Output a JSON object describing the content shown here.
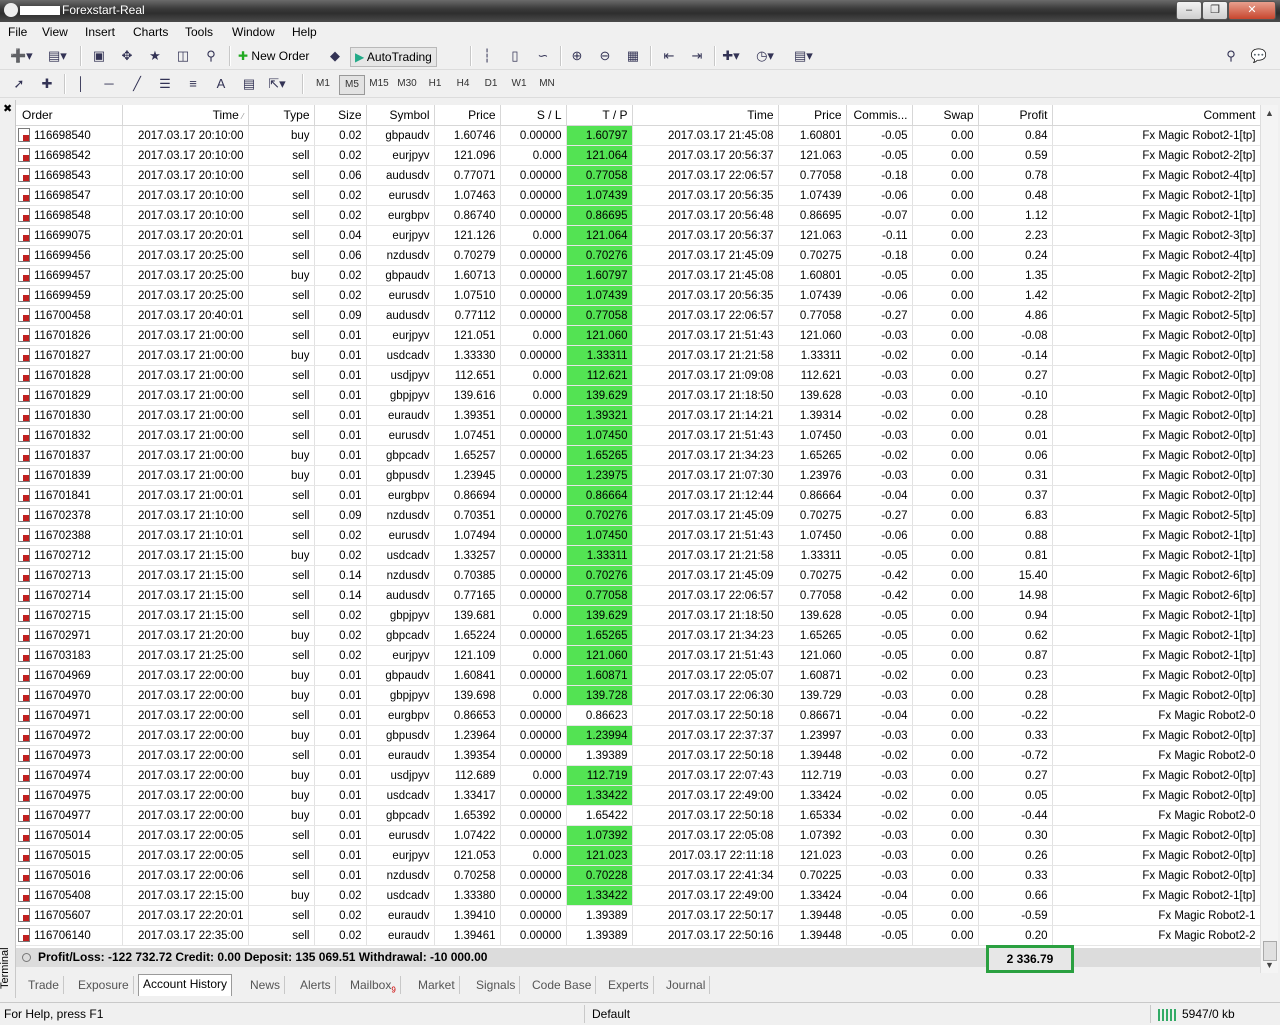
{
  "window": {
    "title": "Forexstart-Real"
  },
  "menu": [
    "File",
    "View",
    "Insert",
    "Charts",
    "Tools",
    "Window",
    "Help"
  ],
  "toolbar": {
    "new_order": "New Order",
    "autotrading": "AutoTrading"
  },
  "timeframes": [
    "M1",
    "M5",
    "M15",
    "M30",
    "H1",
    "H4",
    "D1",
    "W1",
    "MN"
  ],
  "active_timeframe": "M5",
  "columns": [
    "Order",
    "Time",
    "Type",
    "Size",
    "Symbol",
    "Price",
    "S / L",
    "T / P",
    "Time",
    "Price",
    "Commis...",
    "Swap",
    "Profit",
    "Comment"
  ],
  "rows": [
    {
      "order": "116698540",
      "open_time": "2017.03.17 20:10:00",
      "type": "buy",
      "size": "0.02",
      "symbol": "gbpaudv",
      "price": "1.60746",
      "sl": "0.00000",
      "tp": "1.60797",
      "close_time": "2017.03.17 21:45:08",
      "close_price": "1.60801",
      "commission": "-0.05",
      "swap": "0.00",
      "profit": "0.84",
      "comment": "Fx Magic Robot2-1[tp]",
      "tp_hit": true
    },
    {
      "order": "116698542",
      "open_time": "2017.03.17 20:10:00",
      "type": "sell",
      "size": "0.02",
      "symbol": "eurjpyv",
      "price": "121.096",
      "sl": "0.000",
      "tp": "121.064",
      "close_time": "2017.03.17 20:56:37",
      "close_price": "121.063",
      "commission": "-0.05",
      "swap": "0.00",
      "profit": "0.59",
      "comment": "Fx Magic Robot2-2[tp]",
      "tp_hit": true
    },
    {
      "order": "116698543",
      "open_time": "2017.03.17 20:10:00",
      "type": "sell",
      "size": "0.06",
      "symbol": "audusdv",
      "price": "0.77071",
      "sl": "0.00000",
      "tp": "0.77058",
      "close_time": "2017.03.17 22:06:57",
      "close_price": "0.77058",
      "commission": "-0.18",
      "swap": "0.00",
      "profit": "0.78",
      "comment": "Fx Magic Robot2-4[tp]",
      "tp_hit": true
    },
    {
      "order": "116698547",
      "open_time": "2017.03.17 20:10:00",
      "type": "sell",
      "size": "0.02",
      "symbol": "eurusdv",
      "price": "1.07463",
      "sl": "0.00000",
      "tp": "1.07439",
      "close_time": "2017.03.17 20:56:35",
      "close_price": "1.07439",
      "commission": "-0.06",
      "swap": "0.00",
      "profit": "0.48",
      "comment": "Fx Magic Robot2-1[tp]",
      "tp_hit": true
    },
    {
      "order": "116698548",
      "open_time": "2017.03.17 20:10:00",
      "type": "sell",
      "size": "0.02",
      "symbol": "eurgbpv",
      "price": "0.86740",
      "sl": "0.00000",
      "tp": "0.86695",
      "close_time": "2017.03.17 20:56:48",
      "close_price": "0.86695",
      "commission": "-0.07",
      "swap": "0.00",
      "profit": "1.12",
      "comment": "Fx Magic Robot2-1[tp]",
      "tp_hit": true
    },
    {
      "order": "116699075",
      "open_time": "2017.03.17 20:20:01",
      "type": "sell",
      "size": "0.04",
      "symbol": "eurjpyv",
      "price": "121.126",
      "sl": "0.000",
      "tp": "121.064",
      "close_time": "2017.03.17 20:56:37",
      "close_price": "121.063",
      "commission": "-0.11",
      "swap": "0.00",
      "profit": "2.23",
      "comment": "Fx Magic Robot2-3[tp]",
      "tp_hit": true
    },
    {
      "order": "116699456",
      "open_time": "2017.03.17 20:25:00",
      "type": "sell",
      "size": "0.06",
      "symbol": "nzdusdv",
      "price": "0.70279",
      "sl": "0.00000",
      "tp": "0.70276",
      "close_time": "2017.03.17 21:45:09",
      "close_price": "0.70275",
      "commission": "-0.18",
      "swap": "0.00",
      "profit": "0.24",
      "comment": "Fx Magic Robot2-4[tp]",
      "tp_hit": true
    },
    {
      "order": "116699457",
      "open_time": "2017.03.17 20:25:00",
      "type": "buy",
      "size": "0.02",
      "symbol": "gbpaudv",
      "price": "1.60713",
      "sl": "0.00000",
      "tp": "1.60797",
      "close_time": "2017.03.17 21:45:08",
      "close_price": "1.60801",
      "commission": "-0.05",
      "swap": "0.00",
      "profit": "1.35",
      "comment": "Fx Magic Robot2-2[tp]",
      "tp_hit": true
    },
    {
      "order": "116699459",
      "open_time": "2017.03.17 20:25:00",
      "type": "sell",
      "size": "0.02",
      "symbol": "eurusdv",
      "price": "1.07510",
      "sl": "0.00000",
      "tp": "1.07439",
      "close_time": "2017.03.17 20:56:35",
      "close_price": "1.07439",
      "commission": "-0.06",
      "swap": "0.00",
      "profit": "1.42",
      "comment": "Fx Magic Robot2-2[tp]",
      "tp_hit": true
    },
    {
      "order": "116700458",
      "open_time": "2017.03.17 20:40:01",
      "type": "sell",
      "size": "0.09",
      "symbol": "audusdv",
      "price": "0.77112",
      "sl": "0.00000",
      "tp": "0.77058",
      "close_time": "2017.03.17 22:06:57",
      "close_price": "0.77058",
      "commission": "-0.27",
      "swap": "0.00",
      "profit": "4.86",
      "comment": "Fx Magic Robot2-5[tp]",
      "tp_hit": true
    },
    {
      "order": "116701826",
      "open_time": "2017.03.17 21:00:00",
      "type": "sell",
      "size": "0.01",
      "symbol": "eurjpyv",
      "price": "121.051",
      "sl": "0.000",
      "tp": "121.060",
      "close_time": "2017.03.17 21:51:43",
      "close_price": "121.060",
      "commission": "-0.03",
      "swap": "0.00",
      "profit": "-0.08",
      "comment": "Fx Magic Robot2-0[tp]",
      "tp_hit": true
    },
    {
      "order": "116701827",
      "open_time": "2017.03.17 21:00:00",
      "type": "buy",
      "size": "0.01",
      "symbol": "usdcadv",
      "price": "1.33330",
      "sl": "0.00000",
      "tp": "1.33311",
      "close_time": "2017.03.17 21:21:58",
      "close_price": "1.33311",
      "commission": "-0.02",
      "swap": "0.00",
      "profit": "-0.14",
      "comment": "Fx Magic Robot2-0[tp]",
      "tp_hit": true
    },
    {
      "order": "116701828",
      "open_time": "2017.03.17 21:00:00",
      "type": "sell",
      "size": "0.01",
      "symbol": "usdjpyv",
      "price": "112.651",
      "sl": "0.000",
      "tp": "112.621",
      "close_time": "2017.03.17 21:09:08",
      "close_price": "112.621",
      "commission": "-0.03",
      "swap": "0.00",
      "profit": "0.27",
      "comment": "Fx Magic Robot2-0[tp]",
      "tp_hit": true
    },
    {
      "order": "116701829",
      "open_time": "2017.03.17 21:00:00",
      "type": "sell",
      "size": "0.01",
      "symbol": "gbpjpyv",
      "price": "139.616",
      "sl": "0.000",
      "tp": "139.629",
      "close_time": "2017.03.17 21:18:50",
      "close_price": "139.628",
      "commission": "-0.03",
      "swap": "0.00",
      "profit": "-0.10",
      "comment": "Fx Magic Robot2-0[tp]",
      "tp_hit": true
    },
    {
      "order": "116701830",
      "open_time": "2017.03.17 21:00:00",
      "type": "sell",
      "size": "0.01",
      "symbol": "euraudv",
      "price": "1.39351",
      "sl": "0.00000",
      "tp": "1.39321",
      "close_time": "2017.03.17 21:14:21",
      "close_price": "1.39314",
      "commission": "-0.02",
      "swap": "0.00",
      "profit": "0.28",
      "comment": "Fx Magic Robot2-0[tp]",
      "tp_hit": true
    },
    {
      "order": "116701832",
      "open_time": "2017.03.17 21:00:00",
      "type": "sell",
      "size": "0.01",
      "symbol": "eurusdv",
      "price": "1.07451",
      "sl": "0.00000",
      "tp": "1.07450",
      "close_time": "2017.03.17 21:51:43",
      "close_price": "1.07450",
      "commission": "-0.03",
      "swap": "0.00",
      "profit": "0.01",
      "comment": "Fx Magic Robot2-0[tp]",
      "tp_hit": true
    },
    {
      "order": "116701837",
      "open_time": "2017.03.17 21:00:00",
      "type": "buy",
      "size": "0.01",
      "symbol": "gbpcadv",
      "price": "1.65257",
      "sl": "0.00000",
      "tp": "1.65265",
      "close_time": "2017.03.17 21:34:23",
      "close_price": "1.65265",
      "commission": "-0.02",
      "swap": "0.00",
      "profit": "0.06",
      "comment": "Fx Magic Robot2-0[tp]",
      "tp_hit": true
    },
    {
      "order": "116701839",
      "open_time": "2017.03.17 21:00:00",
      "type": "buy",
      "size": "0.01",
      "symbol": "gbpusdv",
      "price": "1.23945",
      "sl": "0.00000",
      "tp": "1.23975",
      "close_time": "2017.03.17 21:07:30",
      "close_price": "1.23976",
      "commission": "-0.03",
      "swap": "0.00",
      "profit": "0.31",
      "comment": "Fx Magic Robot2-0[tp]",
      "tp_hit": true
    },
    {
      "order": "116701841",
      "open_time": "2017.03.17 21:00:01",
      "type": "sell",
      "size": "0.01",
      "symbol": "eurgbpv",
      "price": "0.86694",
      "sl": "0.00000",
      "tp": "0.86664",
      "close_time": "2017.03.17 21:12:44",
      "close_price": "0.86664",
      "commission": "-0.04",
      "swap": "0.00",
      "profit": "0.37",
      "comment": "Fx Magic Robot2-0[tp]",
      "tp_hit": true
    },
    {
      "order": "116702378",
      "open_time": "2017.03.17 21:10:00",
      "type": "sell",
      "size": "0.09",
      "symbol": "nzdusdv",
      "price": "0.70351",
      "sl": "0.00000",
      "tp": "0.70276",
      "close_time": "2017.03.17 21:45:09",
      "close_price": "0.70275",
      "commission": "-0.27",
      "swap": "0.00",
      "profit": "6.83",
      "comment": "Fx Magic Robot2-5[tp]",
      "tp_hit": true
    },
    {
      "order": "116702388",
      "open_time": "2017.03.17 21:10:01",
      "type": "sell",
      "size": "0.02",
      "symbol": "eurusdv",
      "price": "1.07494",
      "sl": "0.00000",
      "tp": "1.07450",
      "close_time": "2017.03.17 21:51:43",
      "close_price": "1.07450",
      "commission": "-0.06",
      "swap": "0.00",
      "profit": "0.88",
      "comment": "Fx Magic Robot2-1[tp]",
      "tp_hit": true
    },
    {
      "order": "116702712",
      "open_time": "2017.03.17 21:15:00",
      "type": "buy",
      "size": "0.02",
      "symbol": "usdcadv",
      "price": "1.33257",
      "sl": "0.00000",
      "tp": "1.33311",
      "close_time": "2017.03.17 21:21:58",
      "close_price": "1.33311",
      "commission": "-0.05",
      "swap": "0.00",
      "profit": "0.81",
      "comment": "Fx Magic Robot2-1[tp]",
      "tp_hit": true
    },
    {
      "order": "116702713",
      "open_time": "2017.03.17 21:15:00",
      "type": "sell",
      "size": "0.14",
      "symbol": "nzdusdv",
      "price": "0.70385",
      "sl": "0.00000",
      "tp": "0.70276",
      "close_time": "2017.03.17 21:45:09",
      "close_price": "0.70275",
      "commission": "-0.42",
      "swap": "0.00",
      "profit": "15.40",
      "comment": "Fx Magic Robot2-6[tp]",
      "tp_hit": true
    },
    {
      "order": "116702714",
      "open_time": "2017.03.17 21:15:00",
      "type": "sell",
      "size": "0.14",
      "symbol": "audusdv",
      "price": "0.77165",
      "sl": "0.00000",
      "tp": "0.77058",
      "close_time": "2017.03.17 22:06:57",
      "close_price": "0.77058",
      "commission": "-0.42",
      "swap": "0.00",
      "profit": "14.98",
      "comment": "Fx Magic Robot2-6[tp]",
      "tp_hit": true
    },
    {
      "order": "116702715",
      "open_time": "2017.03.17 21:15:00",
      "type": "sell",
      "size": "0.02",
      "symbol": "gbpjpyv",
      "price": "139.681",
      "sl": "0.000",
      "tp": "139.629",
      "close_time": "2017.03.17 21:18:50",
      "close_price": "139.628",
      "commission": "-0.05",
      "swap": "0.00",
      "profit": "0.94",
      "comment": "Fx Magic Robot2-1[tp]",
      "tp_hit": true
    },
    {
      "order": "116702971",
      "open_time": "2017.03.17 21:20:00",
      "type": "buy",
      "size": "0.02",
      "symbol": "gbpcadv",
      "price": "1.65224",
      "sl": "0.00000",
      "tp": "1.65265",
      "close_time": "2017.03.17 21:34:23",
      "close_price": "1.65265",
      "commission": "-0.05",
      "swap": "0.00",
      "profit": "0.62",
      "comment": "Fx Magic Robot2-1[tp]",
      "tp_hit": true
    },
    {
      "order": "116703183",
      "open_time": "2017.03.17 21:25:00",
      "type": "sell",
      "size": "0.02",
      "symbol": "eurjpyv",
      "price": "121.109",
      "sl": "0.000",
      "tp": "121.060",
      "close_time": "2017.03.17 21:51:43",
      "close_price": "121.060",
      "commission": "-0.05",
      "swap": "0.00",
      "profit": "0.87",
      "comment": "Fx Magic Robot2-1[tp]",
      "tp_hit": true
    },
    {
      "order": "116704969",
      "open_time": "2017.03.17 22:00:00",
      "type": "buy",
      "size": "0.01",
      "symbol": "gbpaudv",
      "price": "1.60841",
      "sl": "0.00000",
      "tp": "1.60871",
      "close_time": "2017.03.17 22:05:07",
      "close_price": "1.60871",
      "commission": "-0.02",
      "swap": "0.00",
      "profit": "0.23",
      "comment": "Fx Magic Robot2-0[tp]",
      "tp_hit": true
    },
    {
      "order": "116704970",
      "open_time": "2017.03.17 22:00:00",
      "type": "buy",
      "size": "0.01",
      "symbol": "gbpjpyv",
      "price": "139.698",
      "sl": "0.000",
      "tp": "139.728",
      "close_time": "2017.03.17 22:06:30",
      "close_price": "139.729",
      "commission": "-0.03",
      "swap": "0.00",
      "profit": "0.28",
      "comment": "Fx Magic Robot2-0[tp]",
      "tp_hit": true
    },
    {
      "order": "116704971",
      "open_time": "2017.03.17 22:00:00",
      "type": "sell",
      "size": "0.01",
      "symbol": "eurgbpv",
      "price": "0.86653",
      "sl": "0.00000",
      "tp": "0.86623",
      "close_time": "2017.03.17 22:50:18",
      "close_price": "0.86671",
      "commission": "-0.04",
      "swap": "0.00",
      "profit": "-0.22",
      "comment": "Fx Magic Robot2-0",
      "tp_hit": false
    },
    {
      "order": "116704972",
      "open_time": "2017.03.17 22:00:00",
      "type": "buy",
      "size": "0.01",
      "symbol": "gbpusdv",
      "price": "1.23964",
      "sl": "0.00000",
      "tp": "1.23994",
      "close_time": "2017.03.17 22:37:37",
      "close_price": "1.23997",
      "commission": "-0.03",
      "swap": "0.00",
      "profit": "0.33",
      "comment": "Fx Magic Robot2-0[tp]",
      "tp_hit": true
    },
    {
      "order": "116704973",
      "open_time": "2017.03.17 22:00:00",
      "type": "sell",
      "size": "0.01",
      "symbol": "euraudv",
      "price": "1.39354",
      "sl": "0.00000",
      "tp": "1.39389",
      "close_time": "2017.03.17 22:50:18",
      "close_price": "1.39448",
      "commission": "-0.02",
      "swap": "0.00",
      "profit": "-0.72",
      "comment": "Fx Magic Robot2-0",
      "tp_hit": false
    },
    {
      "order": "116704974",
      "open_time": "2017.03.17 22:00:00",
      "type": "buy",
      "size": "0.01",
      "symbol": "usdjpyv",
      "price": "112.689",
      "sl": "0.000",
      "tp": "112.719",
      "close_time": "2017.03.17 22:07:43",
      "close_price": "112.719",
      "commission": "-0.03",
      "swap": "0.00",
      "profit": "0.27",
      "comment": "Fx Magic Robot2-0[tp]",
      "tp_hit": true
    },
    {
      "order": "116704975",
      "open_time": "2017.03.17 22:00:00",
      "type": "buy",
      "size": "0.01",
      "symbol": "usdcadv",
      "price": "1.33417",
      "sl": "0.00000",
      "tp": "1.33422",
      "close_time": "2017.03.17 22:49:00",
      "close_price": "1.33424",
      "commission": "-0.02",
      "swap": "0.00",
      "profit": "0.05",
      "comment": "Fx Magic Robot2-0[tp]",
      "tp_hit": true
    },
    {
      "order": "116704977",
      "open_time": "2017.03.17 22:00:00",
      "type": "buy",
      "size": "0.01",
      "symbol": "gbpcadv",
      "price": "1.65392",
      "sl": "0.00000",
      "tp": "1.65422",
      "close_time": "2017.03.17 22:50:18",
      "close_price": "1.65334",
      "commission": "-0.02",
      "swap": "0.00",
      "profit": "-0.44",
      "comment": "Fx Magic Robot2-0",
      "tp_hit": false
    },
    {
      "order": "116705014",
      "open_time": "2017.03.17 22:00:05",
      "type": "sell",
      "size": "0.01",
      "symbol": "eurusdv",
      "price": "1.07422",
      "sl": "0.00000",
      "tp": "1.07392",
      "close_time": "2017.03.17 22:05:08",
      "close_price": "1.07392",
      "commission": "-0.03",
      "swap": "0.00",
      "profit": "0.30",
      "comment": "Fx Magic Robot2-0[tp]",
      "tp_hit": true
    },
    {
      "order": "116705015",
      "open_time": "2017.03.17 22:00:05",
      "type": "sell",
      "size": "0.01",
      "symbol": "eurjpyv",
      "price": "121.053",
      "sl": "0.000",
      "tp": "121.023",
      "close_time": "2017.03.17 22:11:18",
      "close_price": "121.023",
      "commission": "-0.03",
      "swap": "0.00",
      "profit": "0.26",
      "comment": "Fx Magic Robot2-0[tp]",
      "tp_hit": true
    },
    {
      "order": "116705016",
      "open_time": "2017.03.17 22:00:06",
      "type": "sell",
      "size": "0.01",
      "symbol": "nzdusdv",
      "price": "0.70258",
      "sl": "0.00000",
      "tp": "0.70228",
      "close_time": "2017.03.17 22:41:34",
      "close_price": "0.70225",
      "commission": "-0.03",
      "swap": "0.00",
      "profit": "0.33",
      "comment": "Fx Magic Robot2-0[tp]",
      "tp_hit": true
    },
    {
      "order": "116705408",
      "open_time": "2017.03.17 22:15:00",
      "type": "buy",
      "size": "0.02",
      "symbol": "usdcadv",
      "price": "1.33380",
      "sl": "0.00000",
      "tp": "1.33422",
      "close_time": "2017.03.17 22:49:00",
      "close_price": "1.33424",
      "commission": "-0.04",
      "swap": "0.00",
      "profit": "0.66",
      "comment": "Fx Magic Robot2-1[tp]",
      "tp_hit": true
    },
    {
      "order": "116705607",
      "open_time": "2017.03.17 22:20:01",
      "type": "sell",
      "size": "0.02",
      "symbol": "euraudv",
      "price": "1.39410",
      "sl": "0.00000",
      "tp": "1.39389",
      "close_time": "2017.03.17 22:50:17",
      "close_price": "1.39448",
      "commission": "-0.05",
      "swap": "0.00",
      "profit": "-0.59",
      "comment": "Fx Magic Robot2-1",
      "tp_hit": false
    },
    {
      "order": "116706140",
      "open_time": "2017.03.17 22:35:00",
      "type": "sell",
      "size": "0.02",
      "symbol": "euraudv",
      "price": "1.39461",
      "sl": "0.00000",
      "tp": "1.39389",
      "close_time": "2017.03.17 22:50:16",
      "close_price": "1.39448",
      "commission": "-0.05",
      "swap": "0.00",
      "profit": "0.20",
      "comment": "Fx Magic Robot2-2",
      "tp_hit": false
    }
  ],
  "summary": {
    "text": "Profit/Loss: -122 732.72  Credit: 0.00  Deposit: 135 069.51  Withdrawal: -10 000.00",
    "profit_total": "2 336.79"
  },
  "tabs": [
    {
      "label": "Trade"
    },
    {
      "label": "Exposure"
    },
    {
      "label": "Account History",
      "active": true
    },
    {
      "label": "News"
    },
    {
      "label": "Alerts"
    },
    {
      "label": "Mailbox",
      "badge": "9"
    },
    {
      "label": "Market"
    },
    {
      "label": "Signals"
    },
    {
      "label": "Code Base"
    },
    {
      "label": "Experts"
    },
    {
      "label": "Journal"
    }
  ],
  "terminal_label": "Terminal",
  "status": {
    "help": "For Help, press F1",
    "profile": "Default",
    "traffic": "5947/0 kb"
  },
  "colors": {
    "tp_hit": "#53e353",
    "highlight_border": "#2aa040"
  }
}
